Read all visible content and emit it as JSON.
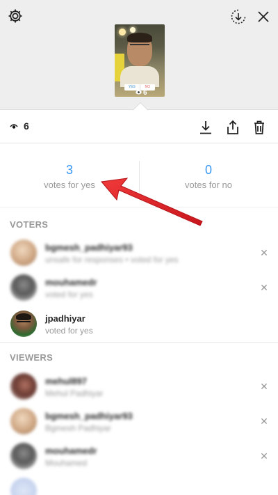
{
  "header": {
    "thumbnail_views": "6",
    "poll_yes": "YES",
    "poll_no": "NO"
  },
  "stats": {
    "view_count": "6"
  },
  "votes": {
    "yes_count": "3",
    "yes_label": "votes for yes",
    "no_count": "0",
    "no_label": "votes for no"
  },
  "voters": {
    "title": "VOTERS",
    "items": [
      {
        "username": "bgmesh_padhiyar93",
        "subtitle": "unsafe for responses • voted for yes",
        "avatar": "beige"
      },
      {
        "username": "mouhamedr",
        "subtitle": "voted for yes",
        "avatar": "gray"
      },
      {
        "username": "jpadhiyar",
        "subtitle": "voted for yes",
        "avatar": "jp"
      }
    ]
  },
  "viewers": {
    "title": "VIEWERS",
    "items": [
      {
        "username": "mehul897",
        "subtitle": "Mehul Padhiyar",
        "avatar": "red"
      },
      {
        "username": "bgmesh_padhiyar93",
        "subtitle": "Bgmesh Padhiyar",
        "avatar": "beige"
      },
      {
        "username": "mouhamedr",
        "subtitle": "Mouhamed",
        "avatar": "gray"
      },
      {
        "username": "",
        "subtitle": "",
        "avatar": "blue"
      }
    ]
  },
  "colors": {
    "accent": "#3897f0",
    "annotation_arrow": "#e0232a"
  }
}
